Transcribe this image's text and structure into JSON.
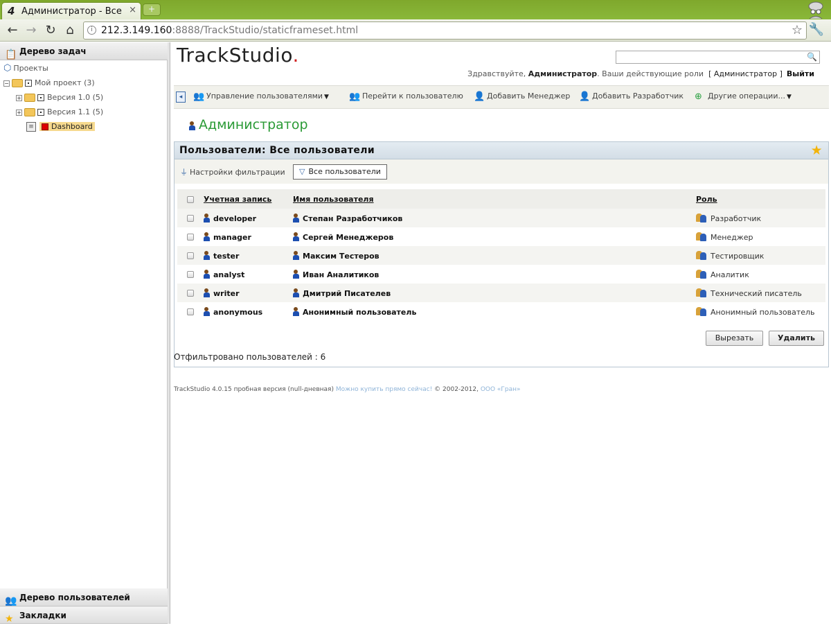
{
  "browser": {
    "tab_title": "Администратор - Все пол",
    "tab_close": "×",
    "new_tab": "+",
    "url_host": "212.3.149.160",
    "url_rest": ":8888/TrackStudio/staticframeset.html"
  },
  "left": {
    "task_tree_title": "Дерево задач",
    "tree": [
      {
        "label": "Проекты"
      },
      {
        "label": "Мой проект (3)"
      },
      {
        "label": "Версия 1.0 (5)"
      },
      {
        "label": "Версия 1.1 (5)"
      },
      {
        "label": "Dashboard"
      }
    ],
    "user_tree_title": "Дерево пользователей",
    "bookmarks_title": "Закладки"
  },
  "header": {
    "brand": "TrackStudio",
    "brand_dot": ".",
    "greet_prefix": "Здравствуйте, ",
    "greet_user": "Администратор",
    "greet_roles_prefix": ". Ваши действующие роли",
    "greet_role": "[ Администратор ]",
    "logout": "Выйти"
  },
  "ops": {
    "manage_users": "Управление пользователями",
    "goto_user": "Перейти к пользователю",
    "add_manager": "Добавить Менеджер",
    "add_developer": "Добавить Разработчик",
    "other_ops": "Другие операции..."
  },
  "page": {
    "user_heading": "Администратор",
    "panel_title": "Пользователи: Все пользователи",
    "filter_settings": "Настройки фильтрации",
    "filter_all": "Все пользователи",
    "columns": {
      "login": "Учетная запись",
      "name": "Имя пользователя",
      "role": "Роль"
    },
    "users": [
      {
        "login": "developer",
        "name": "Степан Разработчиков",
        "role": "Разработчик"
      },
      {
        "login": "manager",
        "name": "Сергей Менеджеров",
        "role": "Менеджер"
      },
      {
        "login": "tester",
        "name": "Максим Тестеров",
        "role": "Тестировщик"
      },
      {
        "login": "analyst",
        "name": "Иван Аналитиков",
        "role": "Аналитик"
      },
      {
        "login": "writer",
        "name": "Дмитрий Писателев",
        "role": "Технический писатель"
      },
      {
        "login": "anonymous",
        "name": "Анонимный пользователь",
        "role": "Анонимный пользователь"
      }
    ],
    "cut_button": "Вырезать",
    "delete_button": "Удалить",
    "filtered_count": "Отфильтровано пользователей : 6"
  },
  "footer": {
    "version": "TrackStudio 4.0.15 пробная версия (null-дневная)",
    "buy_link": "Можно купить прямо сейчас!",
    "copyright": "© 2002-2012,",
    "company_link": "ООО «Гран»"
  },
  "colors": {
    "brand_green": "#2a9a35",
    "chrome_green": "#8ab83a",
    "favorite_star": "#f3b40c"
  }
}
